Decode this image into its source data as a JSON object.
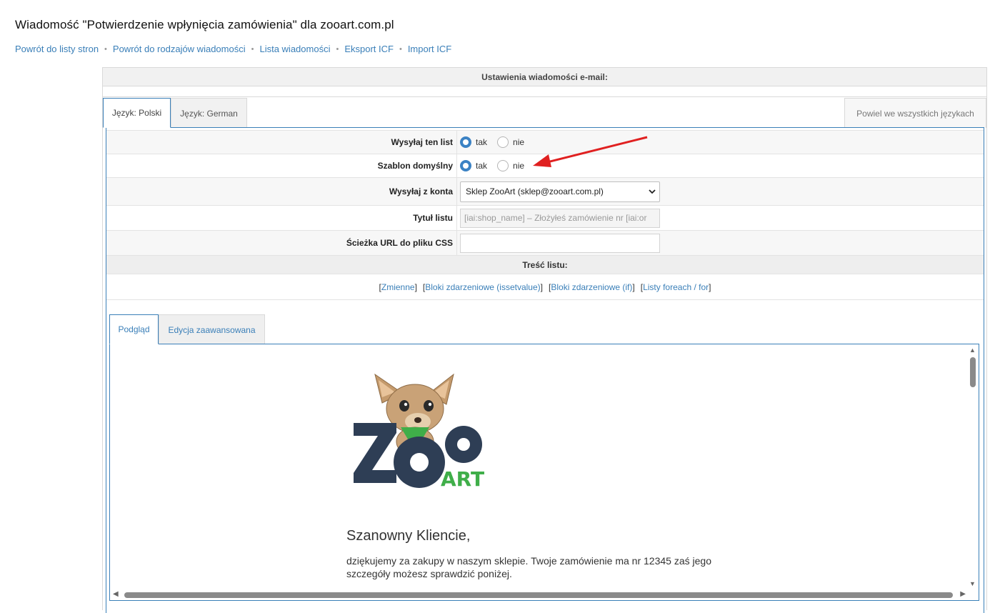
{
  "page": {
    "title": "Wiadomość \"Potwierdzenie wpłynięcia zamówienia\" dla zooart.com.pl"
  },
  "breadcrumbs": [
    {
      "label": "Powrót do listy stron"
    },
    {
      "label": "Powrót do rodzajów wiadomości"
    },
    {
      "label": "Lista wiadomości"
    },
    {
      "label": "Eksport ICF"
    },
    {
      "label": "Import ICF"
    }
  ],
  "settings": {
    "header": "Ustawienia wiadomości e-mail:",
    "tabs": {
      "polish": "Język: Polski",
      "german": "Język: German",
      "duplicate": "Powiel we wszystkich językach"
    },
    "fields": {
      "send_label": "Wysyłaj ten list",
      "send_selected": "tak",
      "default_label": "Szablon domyślny",
      "default_selected": "tak",
      "yes": "tak",
      "no": "nie",
      "account_label": "Wysyłaj z konta",
      "account_value": "Sklep ZooArt (sklep@zooart.com.pl)",
      "subject_label": "Tytuł listu",
      "subject_value": "[iai:shop_name] – Złożyłeś zamówienie nr [iai:or",
      "css_label": "Ścieżka URL do pliku CSS",
      "css_value": ""
    },
    "content_header": "Treść listu:",
    "links": {
      "variables": "Zmienne",
      "issetvalue": "Bloki zdarzeniowe (issetvalue)",
      "if": "Bloki zdarzeniowe (if)",
      "foreach": "Listy foreach / for"
    },
    "edit_tabs": {
      "preview": "Podgląd",
      "advanced": "Edycja zaawansowana"
    }
  },
  "email": {
    "logo_text": "ZOO ART",
    "greeting": "Szanowny Kliencie,",
    "body": "dziękujemy za zakupy w naszym sklepie. Twoje zamówienie ma nr 12345 zaś jego szczegóły możesz sprawdzić poniżej."
  },
  "colors": {
    "link": "#3a7fb8",
    "radio_on": "#3b82c4",
    "arrow": "#e02020",
    "logo_dark": "#2e3e55",
    "logo_green": "#3fae49"
  }
}
